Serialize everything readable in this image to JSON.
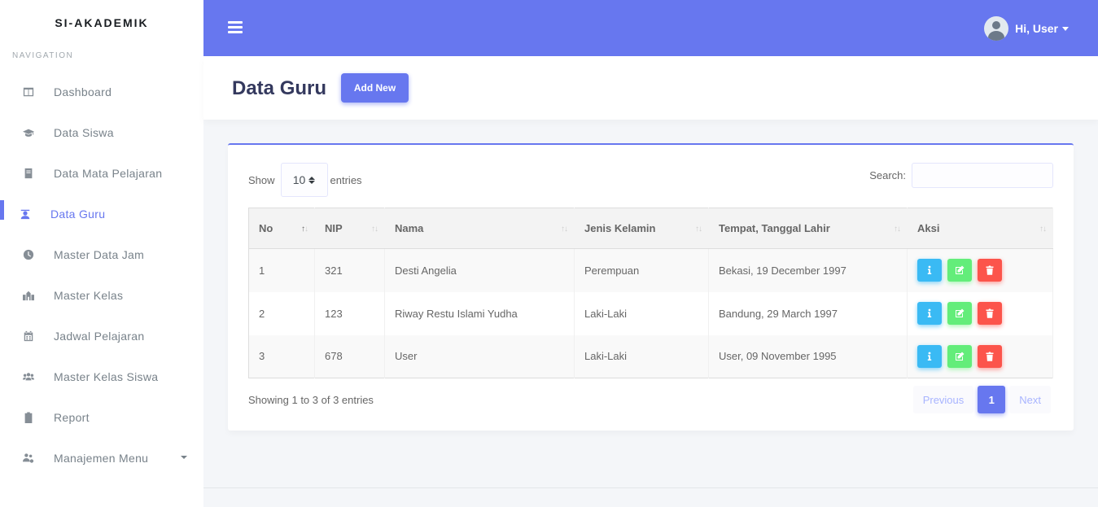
{
  "brand": "SI-AKADEMIK",
  "nav_label": "NAVIGATION",
  "sidebar": {
    "items": [
      {
        "label": "Dashboard",
        "icon": "columns-icon"
      },
      {
        "label": "Data Siswa",
        "icon": "graduation-cap-icon"
      },
      {
        "label": "Data Mata Pelajaran",
        "icon": "book-icon"
      },
      {
        "label": "Data Guru",
        "icon": "teacher-icon"
      },
      {
        "label": "Master Data Jam",
        "icon": "clock-icon"
      },
      {
        "label": "Master Kelas",
        "icon": "school-icon"
      },
      {
        "label": "Jadwal Pelajaran",
        "icon": "calendar-icon"
      },
      {
        "label": "Master Kelas Siswa",
        "icon": "users-icon"
      },
      {
        "label": "Report",
        "icon": "clipboard-icon"
      },
      {
        "label": "Manajemen Menu",
        "icon": "users-cog-icon"
      }
    ],
    "active": "Data Guru"
  },
  "topbar": {
    "user_greeting": "Hi, User"
  },
  "header": {
    "title": "Data Guru",
    "add_button": "Add New"
  },
  "table_controls": {
    "show_label": "Show",
    "entries_value": "10",
    "entries_label": "entries",
    "search_label": "Search:",
    "search_value": ""
  },
  "table": {
    "columns": [
      "No",
      "NIP",
      "Nama",
      "Jenis Kelamin",
      "Tempat, Tanggal Lahir",
      "Aksi"
    ],
    "rows": [
      {
        "no": "1",
        "nip": "321",
        "nama": "Desti Angelia",
        "jk": "Perempuan",
        "ttl": "Bekasi, 19 December 1997"
      },
      {
        "no": "2",
        "nip": "123",
        "nama": "Riway Restu Islami Yudha",
        "jk": "Laki-Laki",
        "ttl": "Bandung, 29 March 1997"
      },
      {
        "no": "3",
        "nip": "678",
        "nama": "User",
        "jk": "Laki-Laki",
        "ttl": "User, 09 November 1995"
      }
    ]
  },
  "footer_info": "Showing 1 to 3 of 3 entries",
  "pagination": {
    "previous": "Previous",
    "current": "1",
    "next": "Next"
  },
  "colors": {
    "primary": "#6777ef",
    "info": "#3abaf4",
    "success": "#63ed7a",
    "danger": "#fc544b"
  }
}
